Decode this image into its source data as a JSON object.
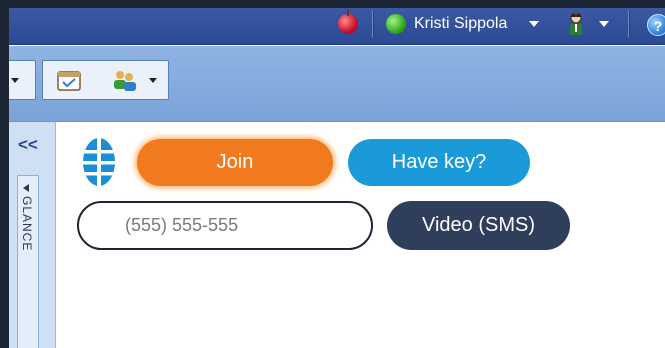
{
  "topbar": {
    "user_name": "Kristi Sippola",
    "status_color": "#2fae1b",
    "icons": [
      "apple-icon",
      "status-indicator-icon",
      "agent-icon",
      "help-icon"
    ],
    "help_glyph": "?"
  },
  "toolbar": {
    "buttons": [
      "calendar-icon",
      "users-icon"
    ]
  },
  "left_panel": {
    "collapse_glyph": "<<",
    "tab_label": "GLANCE"
  },
  "main": {
    "join_label": "Join",
    "have_key_label": "Have key?",
    "phone_placeholder": "(555) 555-555",
    "video_sms_label": "Video (SMS)"
  },
  "colors": {
    "topbar": "#2b4a93",
    "toolbar": "#7aa3d9",
    "join": "#f07a1d",
    "have_key": "#1a9ad8",
    "video_sms": "#2f3e5b"
  }
}
